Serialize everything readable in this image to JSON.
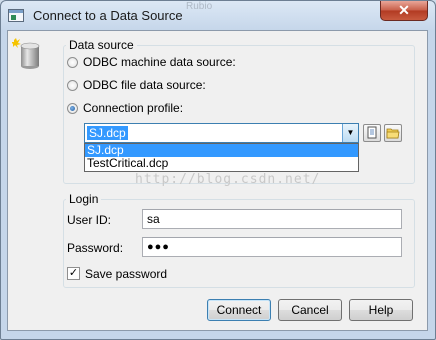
{
  "window": {
    "title": "Connect to a Data Source",
    "ghost_title": "Rubio",
    "close_glyph": "✕"
  },
  "data_source": {
    "group_label": "Data source",
    "options": [
      {
        "label": "ODBC machine data source:",
        "selected": false
      },
      {
        "label": "ODBC file data source:",
        "selected": false
      },
      {
        "label": "Connection profile:",
        "selected": true
      }
    ],
    "profile_combo": {
      "value": "SJ.dcp",
      "arrow_glyph": "▼",
      "items": [
        "SJ.dcp",
        "TestCritical.dcp"
      ],
      "highlighted_index": 0
    },
    "tool_icons": [
      "new-profile-icon",
      "folder-icon"
    ]
  },
  "watermark": "http://blog.csdn.net/",
  "login": {
    "group_label": "Login",
    "user_id_label": "User ID:",
    "user_id_value": "sa",
    "password_label": "Password:",
    "password_value": "●●●",
    "save_password_label": "Save password",
    "save_password_checked": true,
    "check_glyph": "✓"
  },
  "buttons": {
    "connect": "Connect",
    "cancel": "Cancel",
    "help": "Help"
  },
  "colors": {
    "selection": "#3399ff",
    "title_bar": "#c5d6ea",
    "close_button": "#c75d47"
  }
}
